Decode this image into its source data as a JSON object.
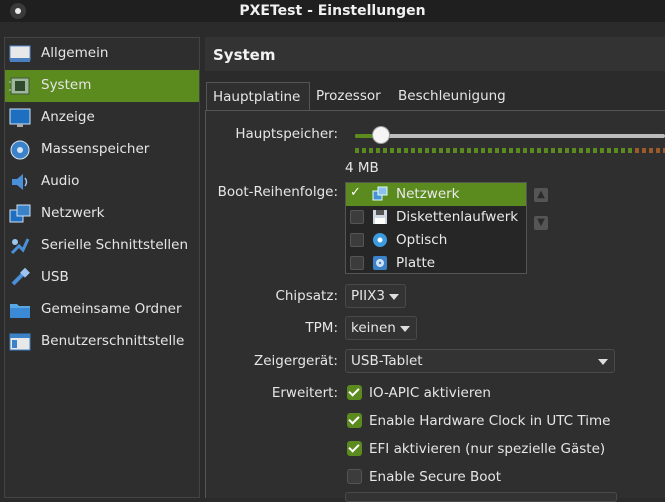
{
  "window": {
    "title": "PXETest - Einstellungen"
  },
  "sidebar": {
    "items": [
      {
        "label": "Allgemein",
        "icon": "general-icon"
      },
      {
        "label": "System",
        "icon": "system-chip-icon",
        "selected": true
      },
      {
        "label": "Anzeige",
        "icon": "display-icon"
      },
      {
        "label": "Massenspeicher",
        "icon": "storage-icon"
      },
      {
        "label": "Audio",
        "icon": "audio-icon"
      },
      {
        "label": "Netzwerk",
        "icon": "network-icon"
      },
      {
        "label": "Serielle Schnittstellen",
        "icon": "serial-port-icon"
      },
      {
        "label": "USB",
        "icon": "usb-icon"
      },
      {
        "label": "Gemeinsame Ordner",
        "icon": "folder-icon"
      },
      {
        "label": "Benutzerschnittstelle",
        "icon": "ui-icon"
      }
    ]
  },
  "main": {
    "section_title": "System",
    "tabs": [
      "Hauptplatine",
      "Prozessor",
      "Beschleunigung"
    ],
    "active_tab": 0,
    "memory": {
      "label": "Hauptspeicher:",
      "value_text": "4 MB"
    },
    "boot": {
      "label": "Boot-Reihenfolge:",
      "items": [
        {
          "label": "Netzwerk",
          "checked": true,
          "icon": "network-icon"
        },
        {
          "label": "Diskettenlaufwerk",
          "checked": false,
          "icon": "floppy-icon"
        },
        {
          "label": "Optisch",
          "checked": false,
          "icon": "optical-disc-icon"
        },
        {
          "label": "Platte",
          "checked": false,
          "icon": "hard-disk-icon"
        }
      ]
    },
    "chipset": {
      "label": "Chipsatz:",
      "value": "PIIX3"
    },
    "tpm": {
      "label": "TPM:",
      "value": "keinen"
    },
    "pointer": {
      "label": "Zeigergerät:",
      "value": "USB-Tablet"
    },
    "extended": {
      "label": "Erweitert:",
      "options": [
        {
          "label": "IO-APIC aktivieren",
          "checked": true
        },
        {
          "label": "Enable Hardware Clock in UTC Time",
          "checked": true
        },
        {
          "label": "EFI aktivieren (nur spezielle Gäste)",
          "checked": true
        },
        {
          "label": "Enable Secure Boot",
          "checked": false
        }
      ]
    }
  },
  "colors": {
    "accent": "#5b8a1e",
    "background": "#2b2b2b",
    "titlebar": "#1f1f1f"
  }
}
